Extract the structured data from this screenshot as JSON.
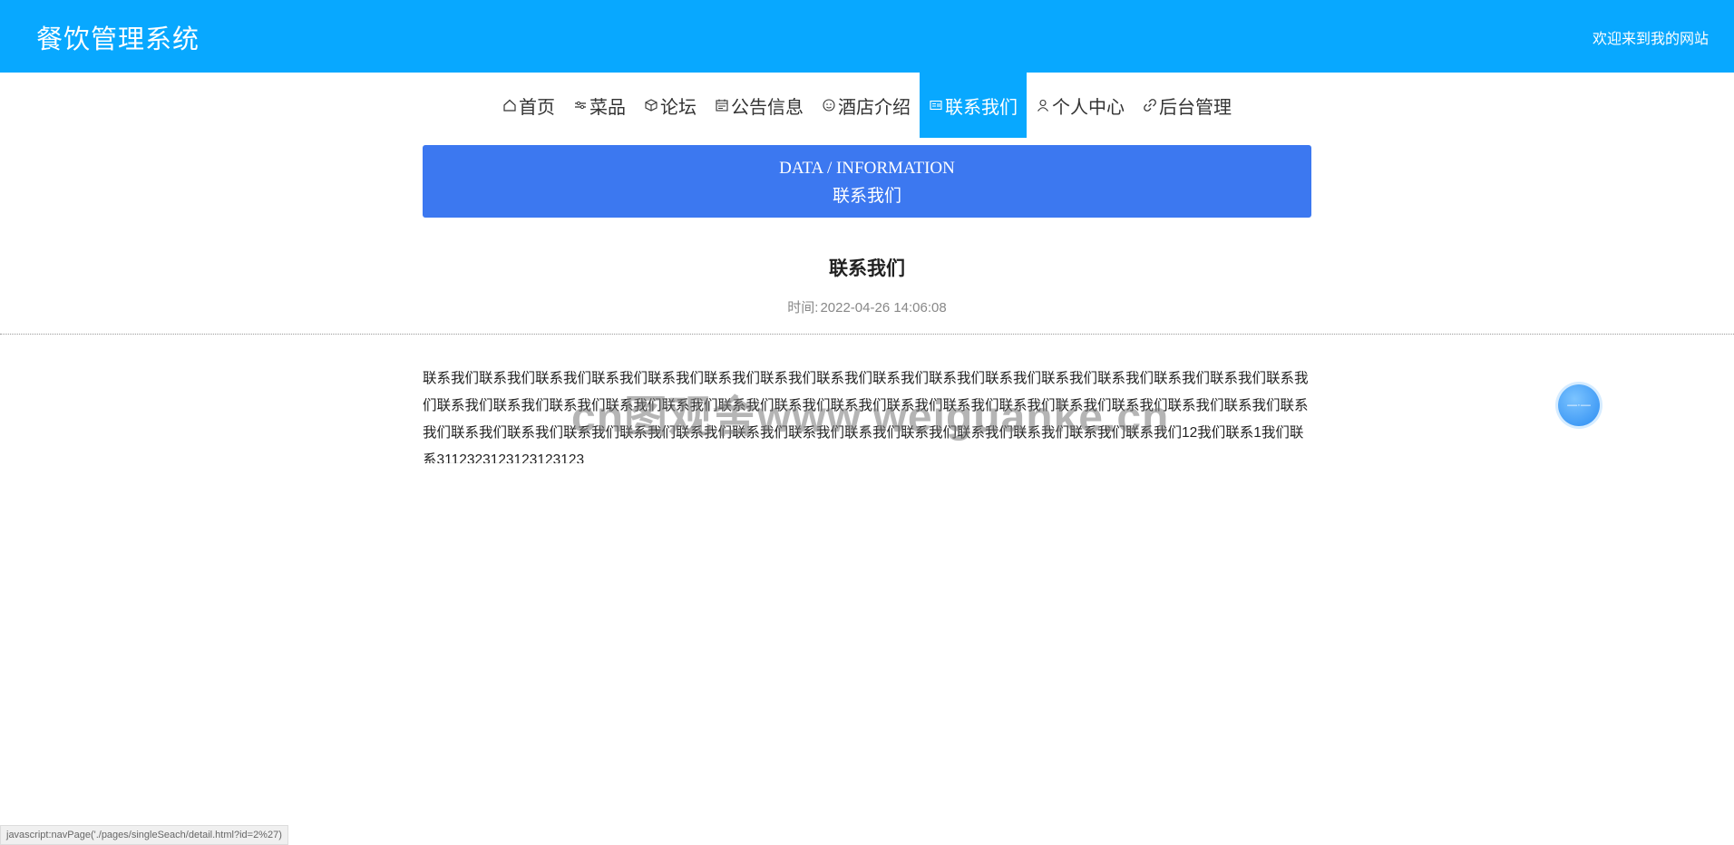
{
  "header": {
    "site_title": "餐饮管理系统",
    "welcome": "欢迎来到我的网站"
  },
  "nav": {
    "items": [
      {
        "label": "首页",
        "icon": "home-icon"
      },
      {
        "label": "菜品",
        "icon": "sliders-icon"
      },
      {
        "label": "论坛",
        "icon": "cube-icon"
      },
      {
        "label": "公告信息",
        "icon": "calendar-icon"
      },
      {
        "label": "酒店介绍",
        "icon": "smile-icon"
      },
      {
        "label": "联系我们",
        "icon": "contact-card-icon",
        "active": true
      },
      {
        "label": "个人中心",
        "icon": "user-icon"
      },
      {
        "label": "后台管理",
        "icon": "link-icon"
      }
    ]
  },
  "banner": {
    "en": "DATA / INFORMATION",
    "cn": "联系我们"
  },
  "article": {
    "title": "联系我们",
    "time_label": "时间:",
    "time_value": "2022-04-26 14:06:08",
    "body": "联系我们联系我们联系我们联系我们联系我们联系我们联系我们联系我们联系我们联系我们联系我们联系我们联系我们联系我们联系我们联系我们联系我们联系我们联系我们联系我们联系我们联系我们联系我们联系我们联系我们联系我们联系我们联系我们联系我们联系我们联系我们联系我们联系我们联系我们联系我们联系我们联系我们联系我们联系我们联系我们联系我们联系我们联系我们联系我们联系我们12我们联系1我们联系3112323123123123123"
  },
  "watermark": "cn图观舍www.weiguanke.cn",
  "status_bar": "javascript:navPage('./pages/singleSeach/detail.html?id=2%27)",
  "colors": {
    "header_bg": "#08a8ff",
    "banner_bg": "#3c78f0",
    "active_nav_bg": "#08a8ff"
  }
}
